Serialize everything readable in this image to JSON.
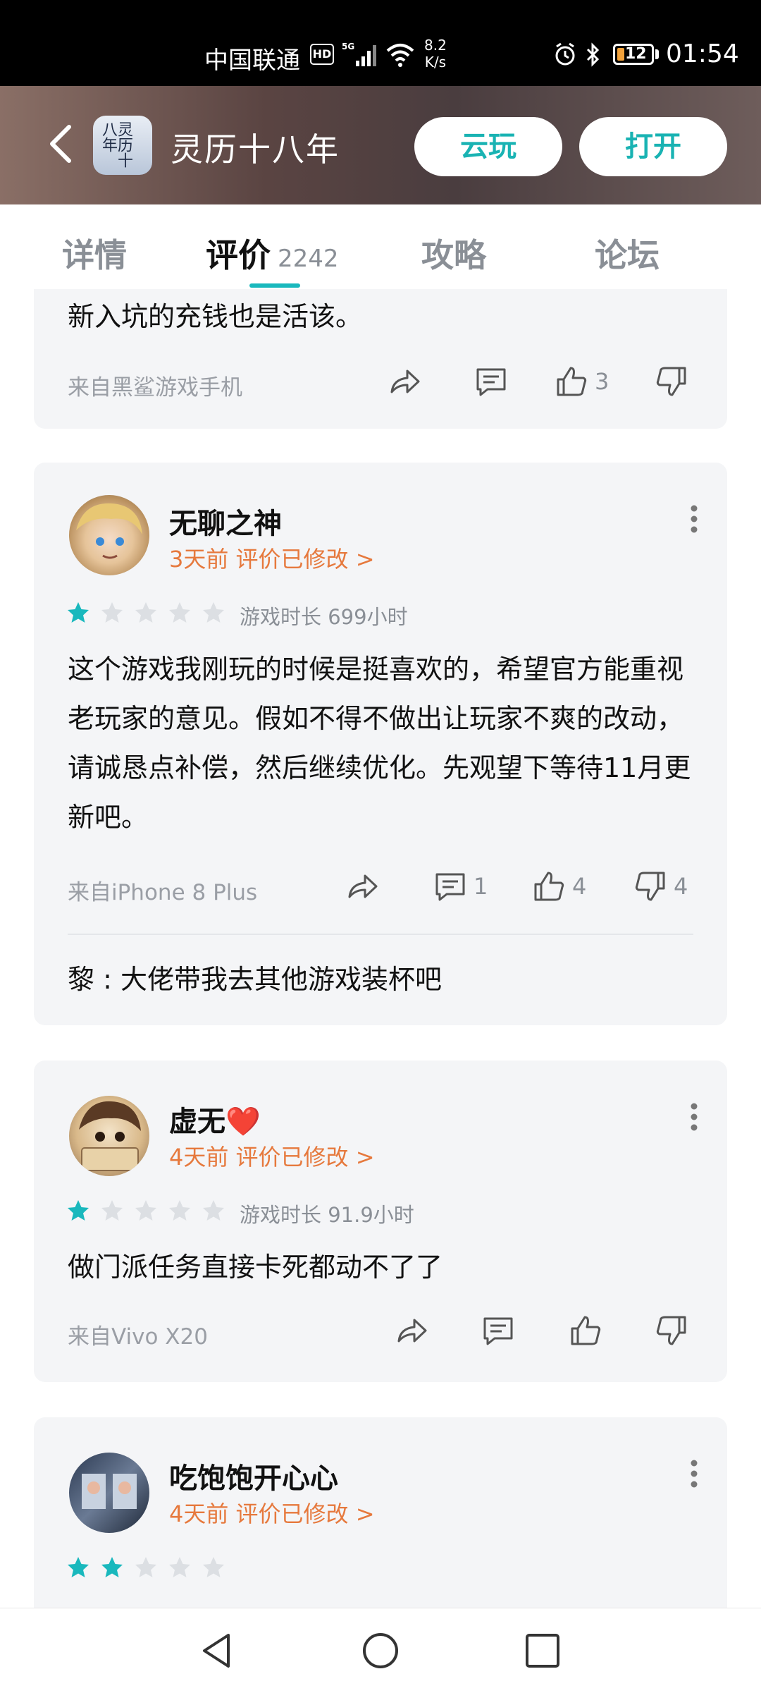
{
  "status_bar": {
    "carrier": "中国联通",
    "hd": "HD",
    "network": "5G",
    "speed_value": "8.2",
    "speed_unit": "K/s",
    "battery": "12",
    "time": "01:54"
  },
  "header": {
    "app_name": "灵历十八年",
    "icon_text": "灵历十八年",
    "cloud_play_label": "云玩",
    "open_label": "打开"
  },
  "tabs": [
    {
      "label": "详情"
    },
    {
      "label": "评价",
      "count": "2242"
    },
    {
      "label": "攻略"
    },
    {
      "label": "论坛"
    }
  ],
  "reviews": [
    {
      "text": "新入坑的充钱也是活该。",
      "device": "来自黑鲨游戏手机",
      "likes": "3"
    },
    {
      "username": "无聊之神",
      "meta": "3天前 评价已修改 >",
      "stars": 1,
      "playtime": "游戏时长 699小时",
      "text": "这个游戏我刚玩的时候是挺喜欢的，希望官方能重视老玩家的意见。假如不得不做出让玩家不爽的改动，请诚恳点补偿，然后继续优化。先观望下等待11月更新吧。",
      "device": "来自iPhone 8 Plus",
      "comments": "1",
      "likes": "4",
      "dislikes": "4",
      "reply": "黎 : 大佬带我去其他游戏装杯吧"
    },
    {
      "username": "虚无❤️",
      "meta": "4天前 评价已修改 >",
      "stars": 1,
      "playtime": "游戏时长 91.9小时",
      "text": "做门派任务直接卡死都动不了了",
      "device": "来自Vivo X20"
    },
    {
      "username": "吃饱饱开心心",
      "meta": "4天前 评价已修改 >",
      "stars": 2
    }
  ],
  "colors": {
    "accent": "#19b8bd",
    "date_orange": "#e6793d",
    "star_on": "#19b8bd",
    "star_off": "#dcdfe3"
  }
}
